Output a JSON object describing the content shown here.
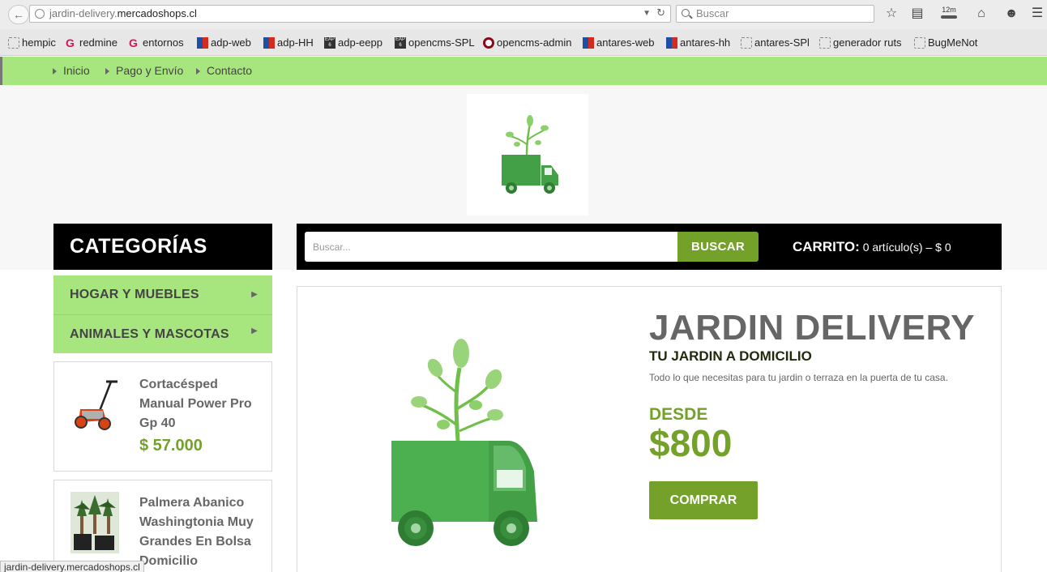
{
  "browser": {
    "url_prefix": "jardin-delivery.",
    "url_host": "mercadoshops.cl",
    "search_placeholder": "Buscar",
    "download_badge": "12m"
  },
  "bookmarks": [
    {
      "label": "hempic",
      "icon": "blank-page-icon"
    },
    {
      "label": "redmine",
      "icon": "g-logo-icon"
    },
    {
      "label": "entornos",
      "icon": "g-logo-icon"
    },
    {
      "label": "adp-web",
      "icon": "chile-flag-icon"
    },
    {
      "label": "adp-HH",
      "icon": "chile-flag-icon"
    },
    {
      "label": "adp-eepp",
      "icon": "eap-icon"
    },
    {
      "label": "opencms-SPL",
      "icon": "eap-icon"
    },
    {
      "label": "opencms-admin",
      "icon": "target-icon"
    },
    {
      "label": "antares-web",
      "icon": "chile-flag-icon"
    },
    {
      "label": "antares-hh",
      "icon": "chile-flag-icon"
    },
    {
      "label": "antares-SPl",
      "icon": "blank-page-icon"
    },
    {
      "label": "generador ruts",
      "icon": "blank-page-icon"
    },
    {
      "label": "BugMeNot",
      "icon": "blank-page-icon"
    }
  ],
  "site_nav": [
    {
      "label": "Inicio"
    },
    {
      "label": "Pago y Envío"
    },
    {
      "label": "Contacto"
    }
  ],
  "sidebar": {
    "title": "CATEGORÍAS",
    "categories": [
      {
        "label": "HOGAR Y MUEBLES"
      },
      {
        "label": "ANIMALES Y MASCOTAS"
      }
    ],
    "products": [
      {
        "name": "Cortacésped Manual Power Pro Gp 40",
        "price": "$ 57.000",
        "image": "lawn-mower-image"
      },
      {
        "name": "Palmera Abanico Washingtonia Muy Grandes En Bolsa Domicilio",
        "price": "",
        "image": "palm-trees-image"
      }
    ]
  },
  "search": {
    "placeholder": "Buscar...",
    "button_label": "BUSCAR"
  },
  "cart": {
    "label": "CARRITO:",
    "summary": "0 artículo(s) – $ 0"
  },
  "hero": {
    "title": "JARDIN DELIVERY",
    "subtitle": "TU JARDIN A DOMICILIO",
    "description": "Todo lo que necesitas para tu jardin o terraza en la puerta de tu casa.",
    "from_label": "DESDE",
    "price": "$800",
    "buy_label": "COMPRAR"
  },
  "status_bar": {
    "url": "jardin-delivery.mercadoshops.cl"
  },
  "colors": {
    "nav_green": "#a7e57e",
    "accent_green": "#73a12a",
    "truck_green": "#4caf50"
  }
}
